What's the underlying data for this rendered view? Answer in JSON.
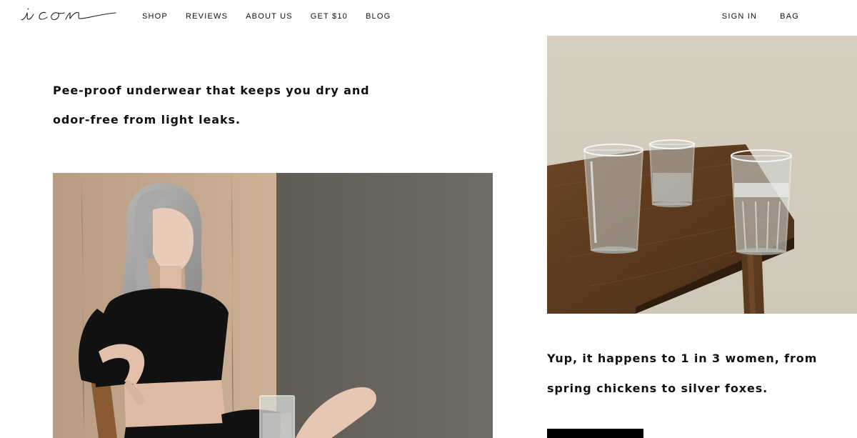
{
  "brand": {
    "logo_text": "icon"
  },
  "nav": {
    "left": [
      {
        "label": "SHOP"
      },
      {
        "label": "REVIEWS"
      },
      {
        "label": "ABOUT US"
      },
      {
        "label": "GET $10"
      },
      {
        "label": "BLOG"
      }
    ],
    "right": [
      {
        "label": "SIGN IN"
      },
      {
        "label": "BAG"
      }
    ]
  },
  "hero": {
    "intro_line_1": "Pee-proof underwear that keeps you dry and",
    "intro_line_2": "odor-free from light leaks."
  },
  "stat": {
    "line_1": "Yup, it happens to 1 in 3 women, from",
    "line_2": "spring chickens to silver foxes."
  },
  "cta": {
    "label": ""
  },
  "colors": {
    "background": "#ffffff",
    "text": "#111111",
    "button": "#000000",
    "wood_wall": "#c4a78c",
    "gray_wall": "#6d6a62",
    "table_wood": "#5a3a1f",
    "beige_wall": "#d8d2c4"
  }
}
